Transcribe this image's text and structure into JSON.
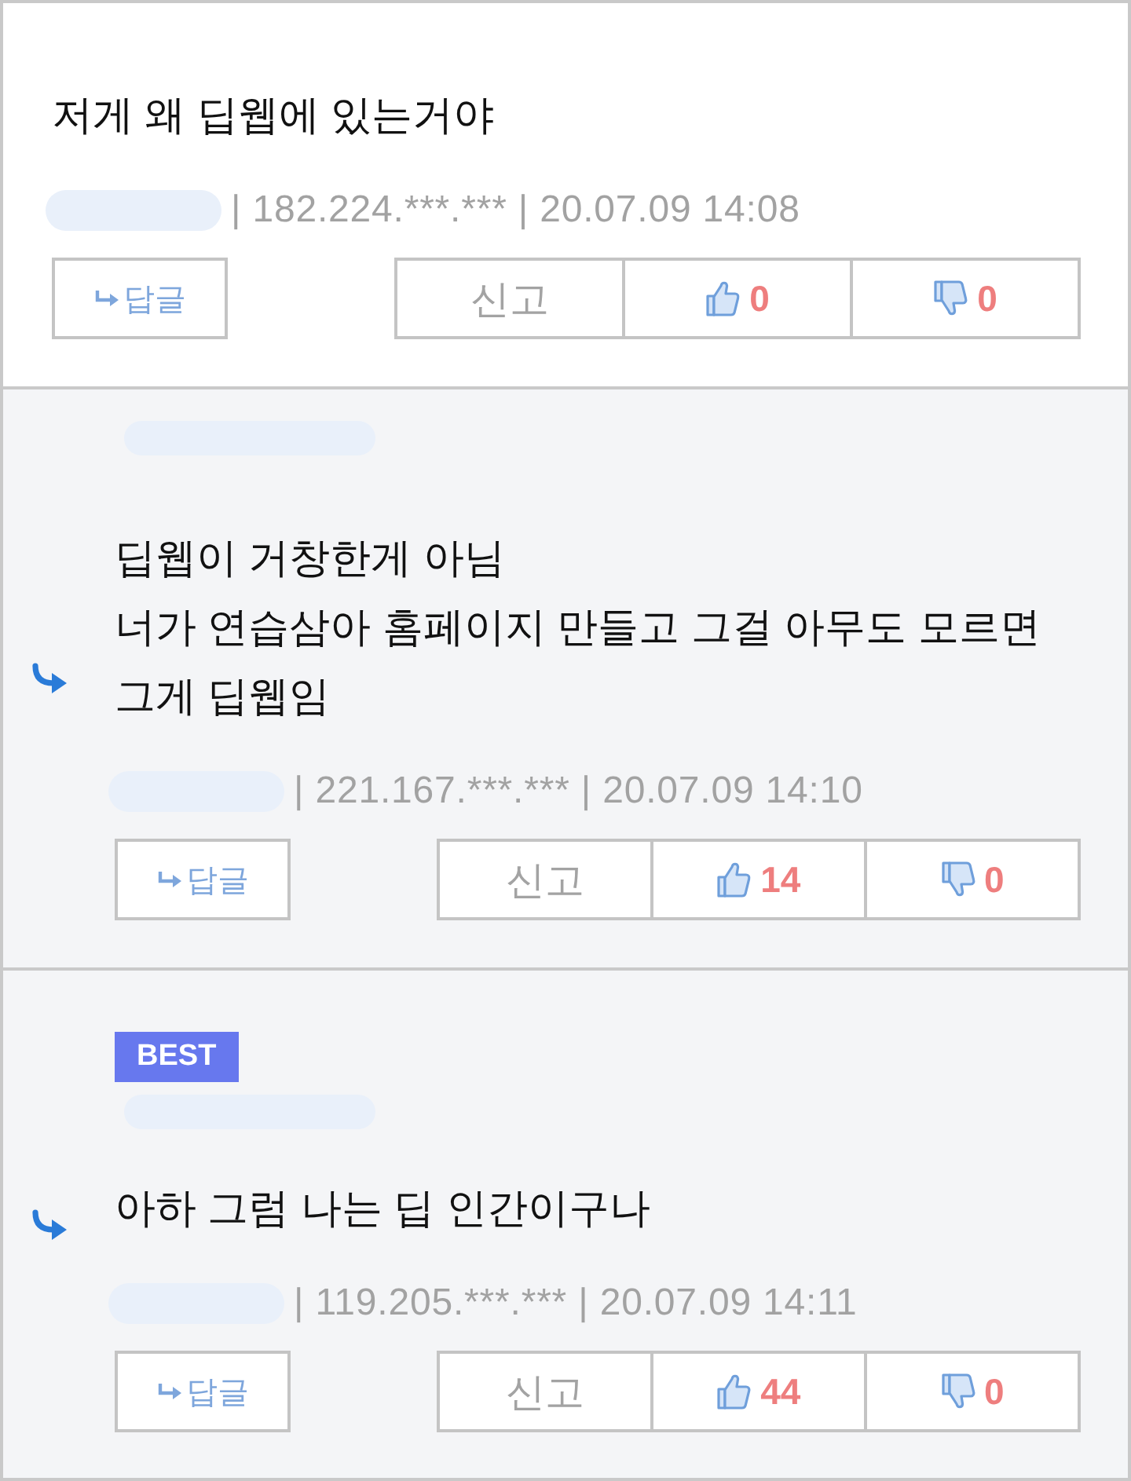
{
  "comments": [
    {
      "kind": "comment",
      "text": "저게 왜 딥웹에 있는거야",
      "meta": "| 182.224.***.*** | 20.07.09 14:08",
      "reply_label": "답글",
      "report_label": "신고",
      "likes": "0",
      "dislikes": "0"
    },
    {
      "kind": "reply",
      "text": "딥웹이 거창한게 아님\n너가 연습삼아 홈페이지 만들고 그걸 아무도 모르면\n그게 딥웹임",
      "meta": "| 221.167.***.*** | 20.07.09 14:10",
      "reply_label": "답글",
      "report_label": "신고",
      "likes": "14",
      "dislikes": "0"
    },
    {
      "kind": "reply",
      "badge": "BEST",
      "text": "아하 그럼 나는 딥 인간이구나",
      "meta": "| 119.205.***.*** | 20.07.09 14:11",
      "reply_label": "답글",
      "report_label": "신고",
      "likes": "44",
      "dislikes": "0"
    }
  ]
}
